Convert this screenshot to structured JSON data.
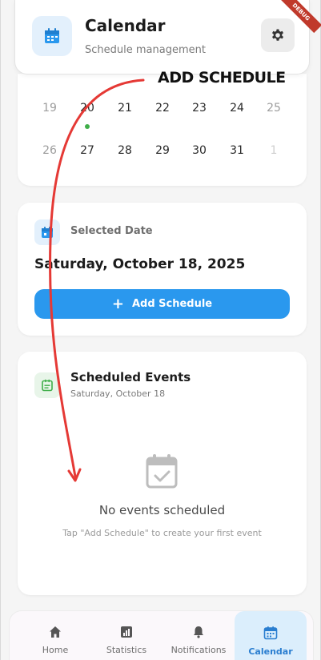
{
  "header": {
    "title": "Calendar",
    "subtitle": "Schedule management",
    "debug_banner": "DEBUG",
    "app_icon": "calendar-icon",
    "settings_icon": "gear-icon"
  },
  "calendar": {
    "week1": [
      "19",
      "20",
      "21",
      "22",
      "23",
      "24",
      "25"
    ],
    "week2": [
      "26",
      "27",
      "28",
      "29",
      "30",
      "31",
      "1"
    ],
    "event_day": "20"
  },
  "selected_date": {
    "label": "Selected Date",
    "date": "Saturday, October 18, 2025",
    "add_button_label": "Add Schedule",
    "icon": "calendar-icon"
  },
  "events": {
    "title": "Scheduled Events",
    "subtitle": "Saturday, October 18",
    "empty_title": "No events scheduled",
    "empty_subtitle": "Tap \"Add Schedule\" to create your first event",
    "icon": "list-calendar-icon"
  },
  "nav": {
    "items": [
      {
        "label": "Home",
        "icon": "home-icon"
      },
      {
        "label": "Statistics",
        "icon": "chart-icon"
      },
      {
        "label": "Notifications",
        "icon": "bell-icon"
      },
      {
        "label": "Calendar",
        "icon": "calendar-icon",
        "active": true
      }
    ]
  },
  "annotation": {
    "text": "ADD SCHEDULE"
  },
  "colors": {
    "accent": "#2a98ee",
    "event_dot": "#3fae49",
    "annotation_arrow": "#e53935",
    "debug_ribbon": "#c0392b"
  }
}
